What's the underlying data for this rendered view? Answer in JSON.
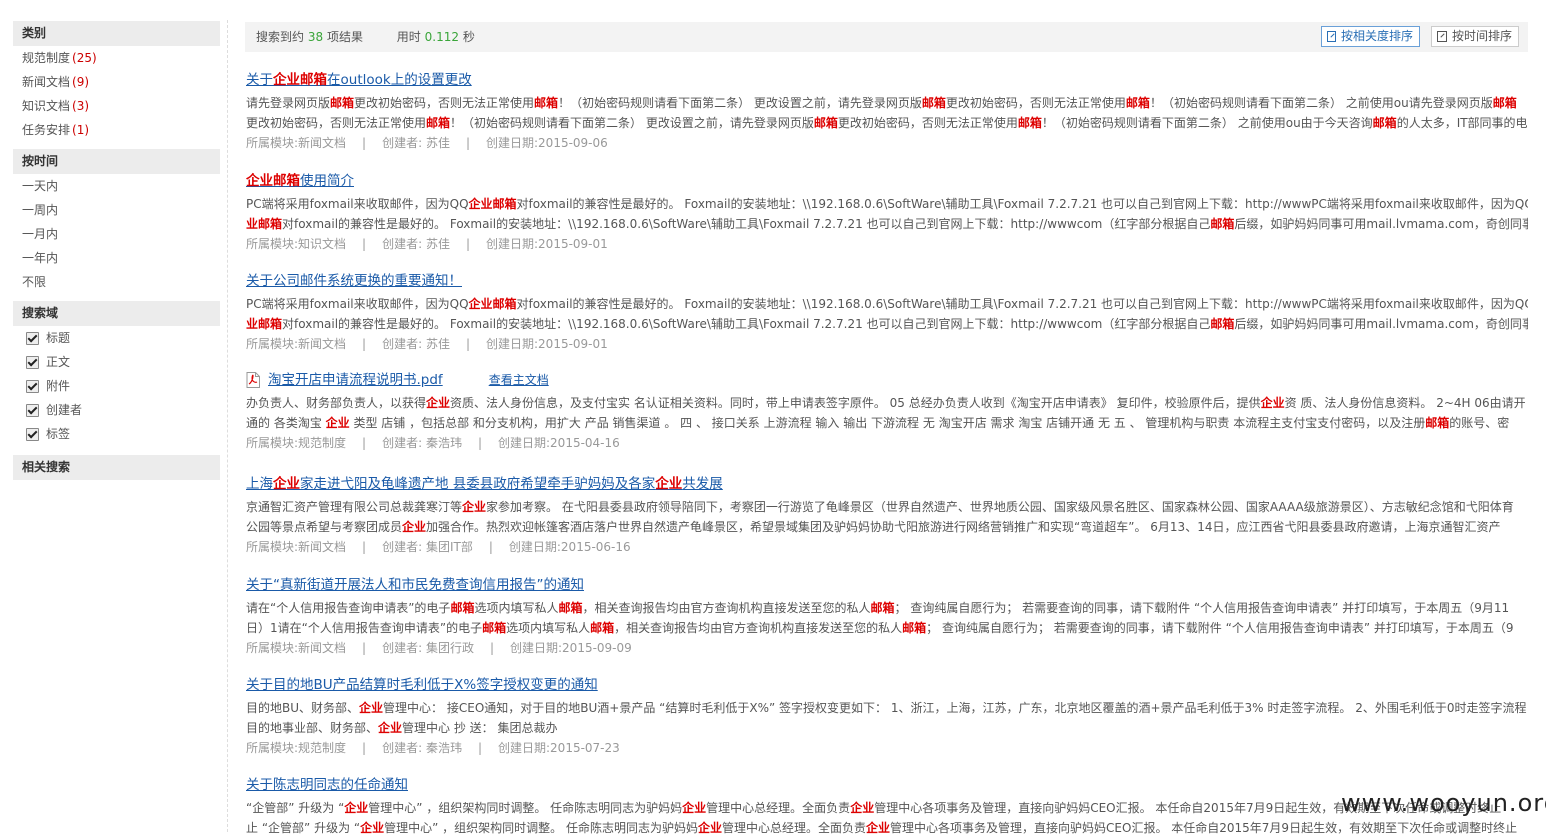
{
  "sidebar": {
    "category": {
      "title": "类别",
      "items": [
        {
          "label": "规范制度",
          "count": "(25)"
        },
        {
          "label": "新闻文档",
          "count": "(9)"
        },
        {
          "label": "知识文档",
          "count": "(3)"
        },
        {
          "label": "任务安排",
          "count": "(1)"
        }
      ]
    },
    "time": {
      "title": "按时间",
      "items": [
        "一天内",
        "一周内",
        "一月内",
        "一年内",
        "不限"
      ]
    },
    "fields": {
      "title": "搜索域",
      "items": [
        "标题",
        "正文",
        "附件",
        "创建者",
        "标签"
      ]
    },
    "related": {
      "title": "相关搜索"
    }
  },
  "topbar": {
    "prefix": "搜索到约",
    "count": "38",
    "suffix": "项结果",
    "time_label": "用时",
    "time_value": "0.112",
    "time_unit": "秒",
    "sort_relevance": "按相关度排序",
    "sort_time": "按时间排序"
  },
  "results": [
    {
      "title": [
        {
          "t": "关于"
        },
        {
          "t": "企业邮箱",
          "h": true
        },
        {
          "t": "在outlook上的设置更改"
        }
      ],
      "lines": [
        [
          {
            "t": "请先登录网页版"
          },
          {
            "t": "邮箱",
            "h": true
          },
          {
            "t": "更改初始密码，否则无法正常使用"
          },
          {
            "t": "邮箱",
            "h": true
          },
          {
            "t": "！（初始密码规则请看下面第二条） 更改设置之前，请先登录网页版"
          },
          {
            "t": "邮箱",
            "h": true
          },
          {
            "t": "更改初始密码，否则无法正常使用"
          },
          {
            "t": "邮箱",
            "h": true
          },
          {
            "t": "！（初始密码规则请看下面第二条） 之前使用ou请先登录网页版"
          },
          {
            "t": "邮箱",
            "h": true
          }
        ],
        [
          {
            "t": "更改初始密码，否则无法正常使用"
          },
          {
            "t": "邮箱",
            "h": true
          },
          {
            "t": "！（初始密码规则请看下面第二条） 更改设置之前，请先登录网页版"
          },
          {
            "t": "邮箱",
            "h": true
          },
          {
            "t": "更改初始密码，否则无法正常使用"
          },
          {
            "t": "邮箱",
            "h": true
          },
          {
            "t": "！（初始密码规则请看下面第二条） 之前使用ou由于今天咨询"
          },
          {
            "t": "邮箱",
            "h": true
          },
          {
            "t": "的人太多，IT部同事的电"
          }
        ]
      ],
      "module": "所属模块:新闻文档",
      "creator": "创建者: 苏佳",
      "date": "创建日期:2015-09-06"
    },
    {
      "title": [
        {
          "t": "企业邮箱",
          "h": true
        },
        {
          "t": "使用简介"
        }
      ],
      "lines": [
        [
          {
            "t": "PC端将采用foxmail来收取邮件，因为QQ"
          },
          {
            "t": "企业邮箱",
            "h": true
          },
          {
            "t": "对foxmail的兼容性是最好的。 Foxmail的安装地址：\\\\192.168.0.6\\SoftWare\\辅助工具\\Foxmail 7.2.7.21 也可以自己到官网上下载：http://wwwPC端将采用foxmail来收取邮件，因为QQ"
          },
          {
            "t": "企",
            "h": true
          }
        ],
        [
          {
            "t": "业邮箱",
            "h": true
          },
          {
            "t": "对foxmail的兼容性是最好的。 Foxmail的安装地址：\\\\192.168.0.6\\SoftWare\\辅助工具\\Foxmail 7.2.7.21 也可以自己到官网上下载：http://wwwcom（红字部分根据自己"
          },
          {
            "t": "邮箱",
            "h": true
          },
          {
            "t": "后缀，如驴妈妈同事可用mail.lvmama.com，奇创同事可"
          }
        ]
      ],
      "module": "所属模块:知识文档",
      "creator": "创建者: 苏佳",
      "date": "创建日期:2015-09-01"
    },
    {
      "title": [
        {
          "t": "关于公司邮件系统更换的重要通知！"
        }
      ],
      "lines": [
        [
          {
            "t": "PC端将采用foxmail来收取邮件，因为QQ"
          },
          {
            "t": "企业邮箱",
            "h": true
          },
          {
            "t": "对foxmail的兼容性是最好的。 Foxmail的安装地址：\\\\192.168.0.6\\SoftWare\\辅助工具\\Foxmail 7.2.7.21 也可以自己到官网上下载：http://wwwPC端将采用foxmail来收取邮件，因为QQ"
          },
          {
            "t": "企",
            "h": true
          }
        ],
        [
          {
            "t": "业邮箱",
            "h": true
          },
          {
            "t": "对foxmail的兼容性是最好的。 Foxmail的安装地址：\\\\192.168.0.6\\SoftWare\\辅助工具\\Foxmail 7.2.7.21 也可以自己到官网上下载：http://wwwcom（红字部分根据自己"
          },
          {
            "t": "邮箱",
            "h": true
          },
          {
            "t": "后缀，如驴妈妈同事可用mail.lvmama.com，奇创同事可"
          }
        ]
      ],
      "module": "所属模块:新闻文档",
      "creator": "创建者: 苏佳",
      "date": "创建日期:2015-09-01"
    },
    {
      "pdf": true,
      "title": [
        {
          "t": "淘宝开店申请流程说明书.pdf"
        }
      ],
      "view_main": "查看主文档",
      "lines": [
        [
          {
            "t": "办负责人、财务部负责人，以获得"
          },
          {
            "t": "企业",
            "h": true
          },
          {
            "t": "资质、法人身份信息，及支付宝实 名认证相关资料。同时，带上申请表签字原件。 05 总经办负责人收到《淘宝开店申请表》 复印件，校验原件后，提供"
          },
          {
            "t": "企业",
            "h": true
          },
          {
            "t": "资 质、法人身份信息资料。 2~4H 06由请开"
          }
        ],
        [
          {
            "t": "通的 各类淘宝 "
          },
          {
            "t": "企业",
            "h": true
          },
          {
            "t": " 类型 店铺 ，包括总部 和分支机构，用扩大 产品 销售渠道 。 四 、 接口关系 上游流程 输入 输出 下游流程 无 淘宝开店 需求 淘宝 店铺开通 无 五 、 管理机构与职责 本流程主支付宝支付密码，以及注册"
          },
          {
            "t": "邮箱",
            "h": true
          },
          {
            "t": "的账号、密"
          }
        ]
      ],
      "module": "所属模块:规范制度",
      "creator": "创建者: 秦浩玮",
      "date": "创建日期:2015-04-16"
    },
    {
      "title": [
        {
          "t": "上海"
        },
        {
          "t": "企业",
          "h": true
        },
        {
          "t": "家走进弋阳及龟峰遗产地 县委县政府希望牵手驴妈妈及各家"
        },
        {
          "t": "企业",
          "h": true
        },
        {
          "t": "共发展"
        }
      ],
      "lines": [
        [
          {
            "t": "京通智汇资产管理有限公司总裁龚寒汀等"
          },
          {
            "t": "企业",
            "h": true
          },
          {
            "t": "家参加考察。 在弋阳县委县政府领导陪同下，考察团一行游览了龟峰景区（世界自然遗产、世界地质公园、国家级风景名胜区、国家森林公园、国家AAAA级旅游景区）、方志敏纪念馆和弋阳体育"
          }
        ],
        [
          {
            "t": "公园等景点希望与考察团成员"
          },
          {
            "t": "企业",
            "h": true
          },
          {
            "t": "加强合作。热烈欢迎帐篷客酒店落户世界自然遗产龟峰景区，希望景域集团及驴妈妈协助弋阳旅游进行网络营销推广和实现“弯道超车”。 6月13、14日，应江西省弋阳县委县政府邀请，上海京通智汇资产"
          }
        ]
      ],
      "module": "所属模块:新闻文档",
      "creator": "创建者: 集团IT部",
      "date": "创建日期:2015-06-16"
    },
    {
      "title": [
        {
          "t": "关于“真新街道开展法人和市民免费查询信用报告”的通知"
        }
      ],
      "lines": [
        [
          {
            "t": "请在“个人信用报告查询申请表”的电子"
          },
          {
            "t": "邮箱",
            "h": true
          },
          {
            "t": "选项内填写私人"
          },
          {
            "t": "邮箱",
            "h": true
          },
          {
            "t": "，相关查询报告均由官方查询机构直接发送至您的私人"
          },
          {
            "t": "邮箱",
            "h": true
          },
          {
            "t": "； 查询纯属自愿行为； 若需要查询的同事，请下载附件 “个人信用报告查询申请表” 并打印填写，于本周五（9月11"
          }
        ],
        [
          {
            "t": "日）1请在“个人信用报告查询申请表”的电子"
          },
          {
            "t": "邮箱",
            "h": true
          },
          {
            "t": "选项内填写私人"
          },
          {
            "t": "邮箱",
            "h": true
          },
          {
            "t": "，相关查询报告均由官方查询机构直接发送至您的私人"
          },
          {
            "t": "邮箱",
            "h": true
          },
          {
            "t": "； 查询纯属自愿行为； 若需要查询的同事，请下载附件 “个人信用报告查询申请表” 并打印填写，于本周五（9"
          }
        ]
      ],
      "module": "所属模块:新闻文档",
      "creator": "创建者: 集团行政",
      "date": "创建日期:2015-09-09"
    },
    {
      "title": [
        {
          "t": "关于目的地BU产品结算时毛利低于X%签字授权变更的通知"
        }
      ],
      "lines": [
        [
          {
            "t": "目的地BU、财务部、"
          },
          {
            "t": "企业",
            "h": true
          },
          {
            "t": "管理中心： 接CEO通知，对于目的地BU酒+景产品 “结算时毛利低于X%” 签字授权变更如下： 1、浙江，上海，江苏，广东，北京地区覆盖的酒+景产品毛利低于3% 时走签字流程。 2、外围毛利低于0时走签字流程"
          }
        ],
        [
          {
            "t": "目的地事业部、财务部、"
          },
          {
            "t": "企业",
            "h": true
          },
          {
            "t": "管理中心 抄 送： 集团总裁办"
          }
        ]
      ],
      "module": "所属模块:规范制度",
      "creator": "创建者: 秦浩玮",
      "date": "创建日期:2015-07-23"
    },
    {
      "title": [
        {
          "t": "关于陈志明同志的任命通知"
        }
      ],
      "lines": [
        [
          {
            "t": " “企管部” 升级为 “"
          },
          {
            "t": "企业",
            "h": true
          },
          {
            "t": "管理中心” ，组织架构同时调整。 任命陈志明同志为驴妈妈"
          },
          {
            "t": "企业",
            "h": true
          },
          {
            "t": "管理中心总经理。全面负责"
          },
          {
            "t": "企业",
            "h": true
          },
          {
            "t": "管理中心各项事务及管理，直接向驴妈妈CEO汇报。 本任命自2015年7月9日起生效，有效期至下次任命或调整时终止"
          }
        ],
        [
          {
            "t": "止 “企管部” 升级为 “"
          },
          {
            "t": "企业",
            "h": true
          },
          {
            "t": "管理中心” ，组织架构同时调整。 任命陈志明同志为驴妈妈"
          },
          {
            "t": "企业",
            "h": true
          },
          {
            "t": "管理中心总经理。全面负责"
          },
          {
            "t": "企业",
            "h": true
          },
          {
            "t": "管理中心各项事务及管理，直接向驴妈妈CEO汇报。 本任命自2015年7月9日起生效，有效期至下次任命或调整时终止"
          }
        ]
      ]
    }
  ],
  "watermark": "www.wooyun.org",
  "colors": {
    "link": "#1a5aa8",
    "highlight": "#dd0000",
    "count": "#3aa53a"
  }
}
